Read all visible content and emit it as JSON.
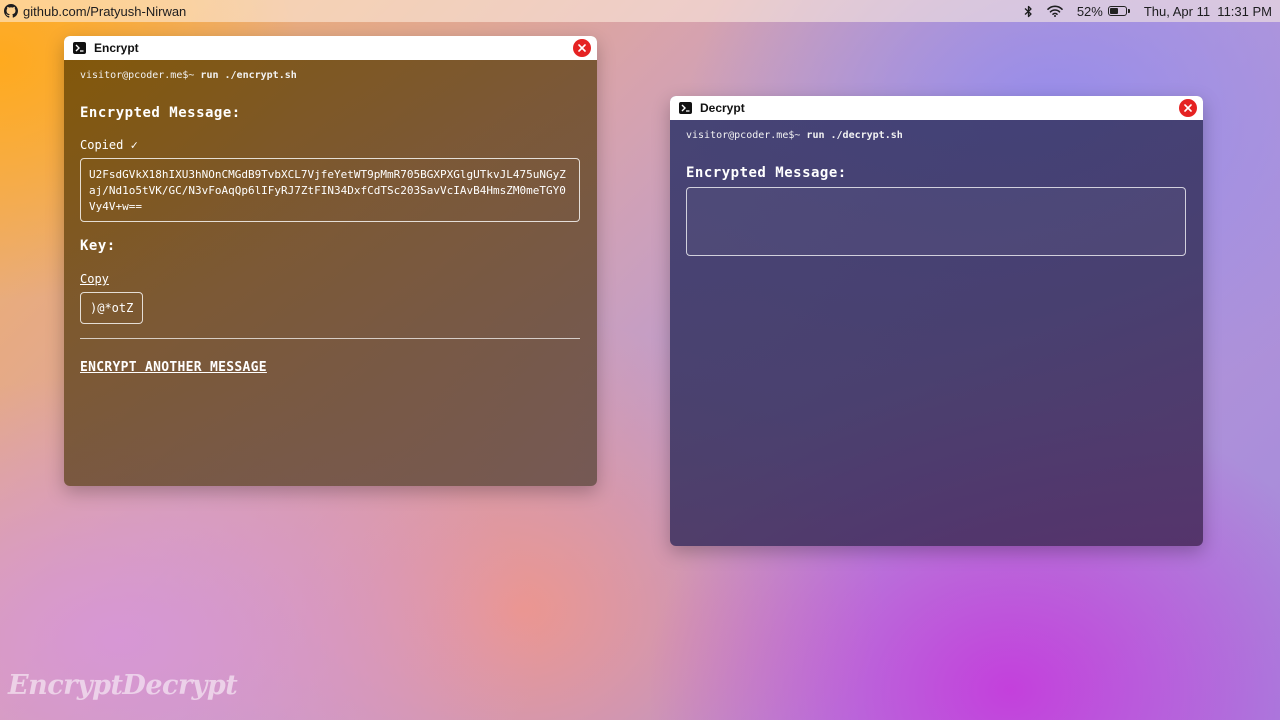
{
  "menubar": {
    "url_text": "github.com/Pratyush-Nirwan",
    "battery_percent": "52%",
    "battery_level": 0.52,
    "datetime": "Thu, Apr 11  11:31 PM",
    "icons": [
      "github-icon",
      "bluetooth-icon",
      "wifi-icon",
      "battery-icon"
    ]
  },
  "encrypt_window": {
    "title": "Encrypt",
    "prompt_user": "visitor@pcoder.me$~",
    "prompt_command": "run ./encrypt.sh",
    "encrypted_heading": "Encrypted Message:",
    "copied_status": "Copied ✓",
    "encrypted_value": "U2FsdGVkX18hIXU3hNOnCMGdB9TvbXCL7VjfeYetWT9pMmR705BGXPXGlgUTkvJL475uNGyZaj/Nd1o5tVK/GC/N3vFoAqQp6lIFyRJ7ZtFIN34DxfCdTSc203SavVcIAvB4HmsZM0meTGY0Vy4V+w==",
    "key_heading": "Key:",
    "copy_label": "Copy",
    "key_value": ")@*otZ",
    "encrypt_another_label": "ENCRYPT ANOTHER MESSAGE"
  },
  "decrypt_window": {
    "title": "Decrypt",
    "prompt_user": "visitor@pcoder.me$~",
    "prompt_command": "run ./decrypt.sh",
    "encrypted_heading": "Encrypted Message:",
    "input_value": ""
  },
  "watermark_text": "EncryptDecrypt",
  "colors": {
    "close_button": "#e52222",
    "titlebar": "#ffffff",
    "text": "#ffffff"
  }
}
